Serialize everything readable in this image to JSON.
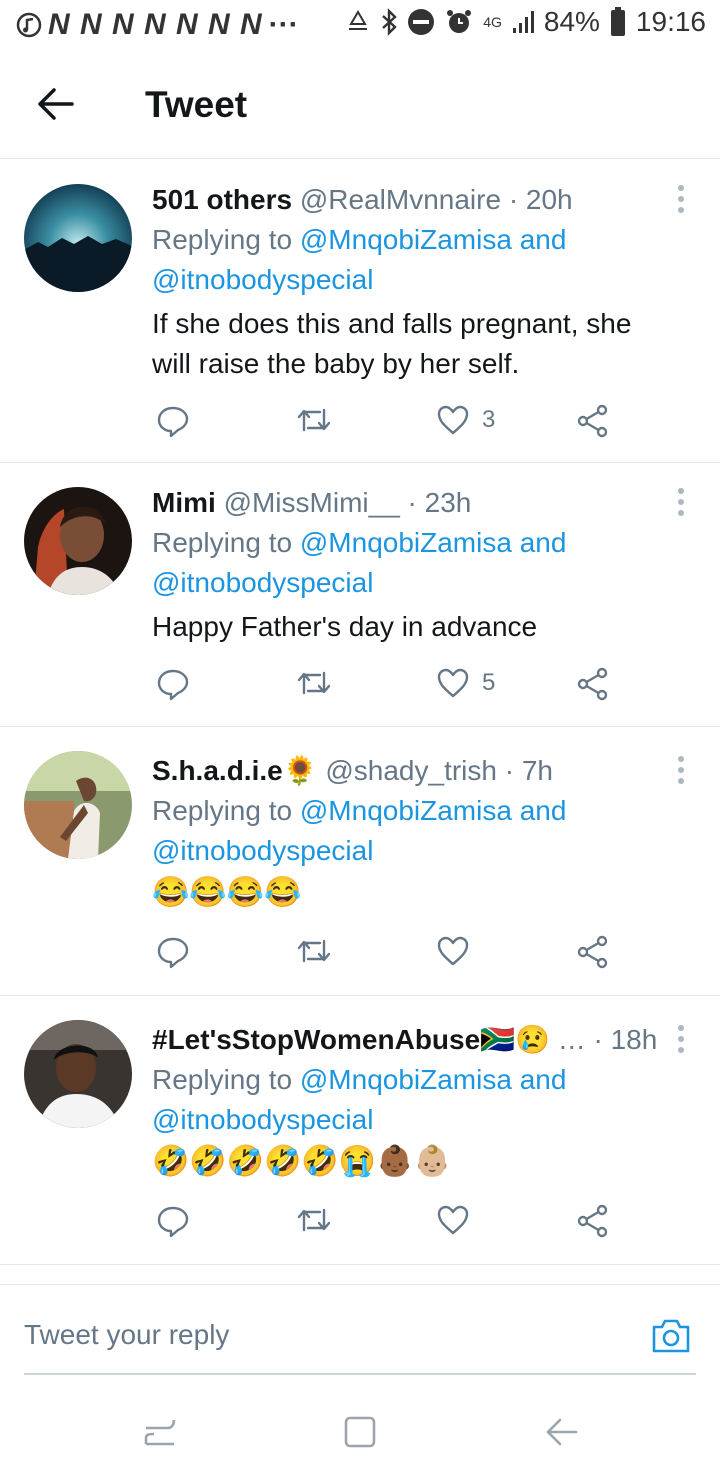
{
  "status": {
    "battery": "84%",
    "time": "19:16",
    "signal": "4G",
    "notification_letters": "N N N N N N N",
    "more": "···"
  },
  "header": {
    "title": "Tweet"
  },
  "tweets": [
    {
      "name": "501 others",
      "handle": "@RealMvnnaire",
      "time": "· 20h",
      "replying_to_prefix": "Replying to",
      "mention1": "@MnqobiZamisa and",
      "mention2": "@itnobodyspecial",
      "text": "If she does this and falls pregnant, she will raise the baby by her self.",
      "likes": "3"
    },
    {
      "name": "Mimi",
      "handle": "@MissMimi__",
      "time": "· 23h",
      "replying_to_prefix": "Replying to",
      "mention1": "@MnqobiZamisa and",
      "mention2": "@itnobodyspecial",
      "text": "Happy Father's day in advance",
      "likes": "5"
    },
    {
      "name": "S.h.a.d.i.e🌻",
      "handle": "@shady_trish",
      "time": "· 7h",
      "replying_to_prefix": "Replying to",
      "mention1": "@MnqobiZamisa and",
      "mention2": "@itnobodyspecial",
      "text": "😂😂😂😂",
      "likes": ""
    },
    {
      "name": "#Let'sStopWomenAbuse🇿🇦😢",
      "handle": "…",
      "time": "· 18h",
      "replying_to_prefix": "Replying to",
      "mention1": "@MnqobiZamisa and",
      "mention2": "@itnobodyspecial",
      "text": "🤣🤣🤣🤣🤣😭👶🏾👶🏼",
      "likes": ""
    }
  ],
  "reply": {
    "placeholder": "Tweet your reply"
  },
  "colors": {
    "link": "#1b95e0",
    "secondary": "#657786",
    "divider": "#e1e8ed"
  },
  "icons": {
    "back": "arrow-left-icon",
    "more": "vertical-dots-icon",
    "reply": "speech-bubble-icon",
    "retweet": "retweet-icon",
    "like": "heart-icon",
    "share": "share-icon",
    "camera": "camera-icon"
  }
}
